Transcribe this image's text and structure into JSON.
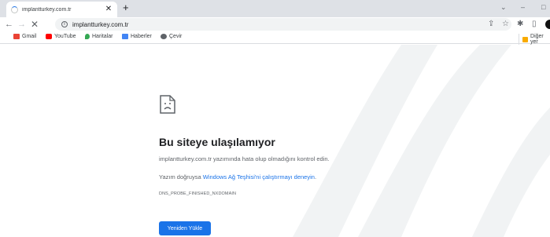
{
  "tab": {
    "title": "implantturkey.com.tr"
  },
  "window": {
    "minimize": "–",
    "maximize": "□"
  },
  "toolbar": {
    "url": "implantturkey.com.tr"
  },
  "bookmarks": {
    "items": [
      {
        "label": "Gmail",
        "icon": "gmail-icon",
        "color": "#ea4335"
      },
      {
        "label": "YouTube",
        "icon": "youtube-icon",
        "color": "#ff0000"
      },
      {
        "label": "Haritalar",
        "icon": "maps-icon",
        "color": "#34a853"
      },
      {
        "label": "Haberler",
        "icon": "news-icon",
        "color": "#4285f4"
      },
      {
        "label": "Çevir",
        "icon": "translate-icon",
        "color": "#5f6368"
      }
    ],
    "other": "Diğer yer"
  },
  "error": {
    "heading": "Bu siteye ulaşılamıyor",
    "line1": "implantturkey.com.tr yazımında hata olup olmadığını kontrol edin.",
    "line2_prefix": "Yazım doğruysa ",
    "line2_link": "Windows Ağ Teşhisi'ni çalıştırmayı deneyin",
    "line2_suffix": ".",
    "code": "DNS_PROBE_FINISHED_NXDOMAIN",
    "button": "Yeniden Yükle"
  },
  "colors": {
    "accent": "#1a73e8",
    "swoosh": "#f1f3f4"
  }
}
